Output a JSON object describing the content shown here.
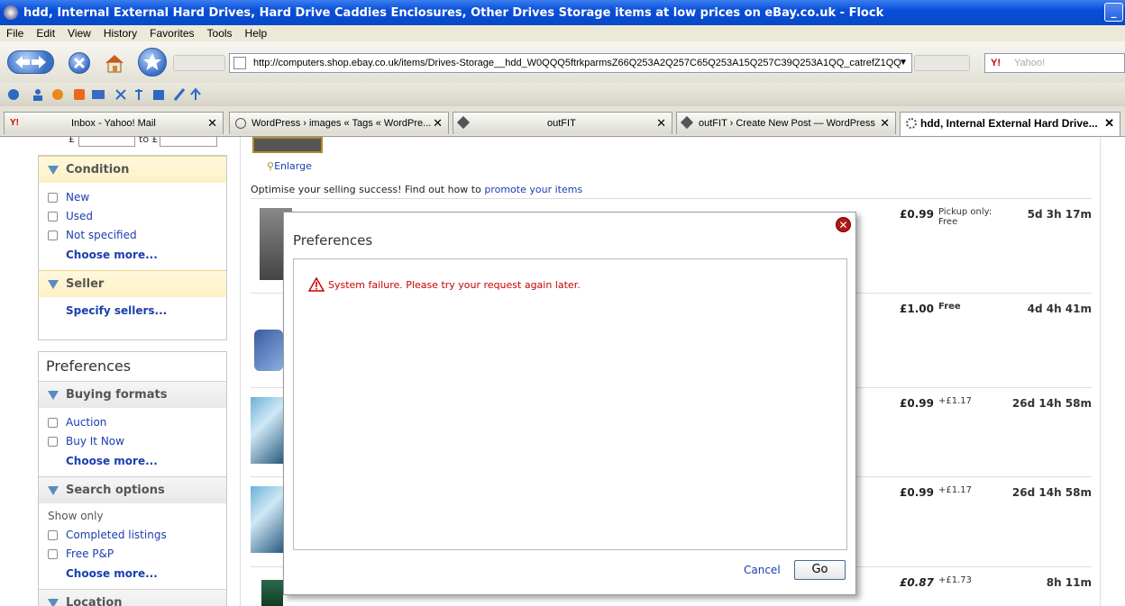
{
  "window": {
    "title": "hdd, Internal External Hard Drives, Hard Drive Caddies Enclosures, Other Drives Storage items at low prices on eBay.co.uk - Flock"
  },
  "menu": [
    "File",
    "Edit",
    "View",
    "History",
    "Favorites",
    "Tools",
    "Help"
  ],
  "address": {
    "url": "http://computers.shop.ebay.co.uk/items/Drives-Storage__hdd_W0QQQ5ftrkparmsZ66Q253A2Q257C65Q253A15Q257C39Q253A1QQ_catrefZ1QQ"
  },
  "search": {
    "placeholder": "Yahoo!"
  },
  "tabs": [
    {
      "label": "Inbox - Yahoo! Mail",
      "icon": "yahoo-icon"
    },
    {
      "label": "WordPress › images « Tags « WordPre...",
      "icon": "wordpress-icon"
    },
    {
      "label": "outFIT",
      "icon": "cube-icon"
    },
    {
      "label": "outFIT › Create New Post — WordPress",
      "icon": "cube-icon"
    },
    {
      "label": "hdd, Internal External Hard Drive...",
      "icon": "loading-icon",
      "active": true
    }
  ],
  "sidebar": {
    "price_from_prefix": "£",
    "price_to_label": "to £",
    "condition": {
      "title": "Condition",
      "items": [
        "New",
        "Used",
        "Not specified"
      ],
      "more": "Choose more..."
    },
    "seller": {
      "title": "Seller",
      "link": "Specify sellers..."
    },
    "preferences": {
      "title": "Preferences",
      "buying_formats": {
        "title": "Buying formats",
        "items": [
          "Auction",
          "Buy It Now"
        ],
        "more": "Choose more..."
      },
      "search_options": {
        "title": "Search options",
        "show_only": "Show only",
        "items": [
          "Completed listings",
          "Free P&P"
        ],
        "more": "Choose more..."
      },
      "location": {
        "title": "Location"
      }
    }
  },
  "main": {
    "enlarge": "Enlarge",
    "promo_text": "Optimise your selling success! Find out how to",
    "promo_link": "promote your items",
    "listings": [
      {
        "price": "£0.99",
        "postage": "Pickup only: Free",
        "time_left": "5d 3h 17m"
      },
      {
        "price": "£1.00",
        "postage": "Free",
        "time_left": "4d 4h 41m"
      },
      {
        "price": "£0.99",
        "postage": "+£1.17",
        "time_left": "26d 14h 58m"
      },
      {
        "price": "£0.99",
        "postage": "+£1.17",
        "time_left": "26d 14h 58m"
      },
      {
        "price": "£0.87",
        "postage": "+£1.73",
        "time_left": "8h 11m"
      }
    ]
  },
  "modal": {
    "title": "Preferences",
    "error": "System failure. Please try your request again later.",
    "cancel": "Cancel",
    "go": "Go"
  },
  "colors": {
    "link": "#1a3eb0",
    "error": "#cc0000",
    "title_bar": "#0a4fd8"
  }
}
